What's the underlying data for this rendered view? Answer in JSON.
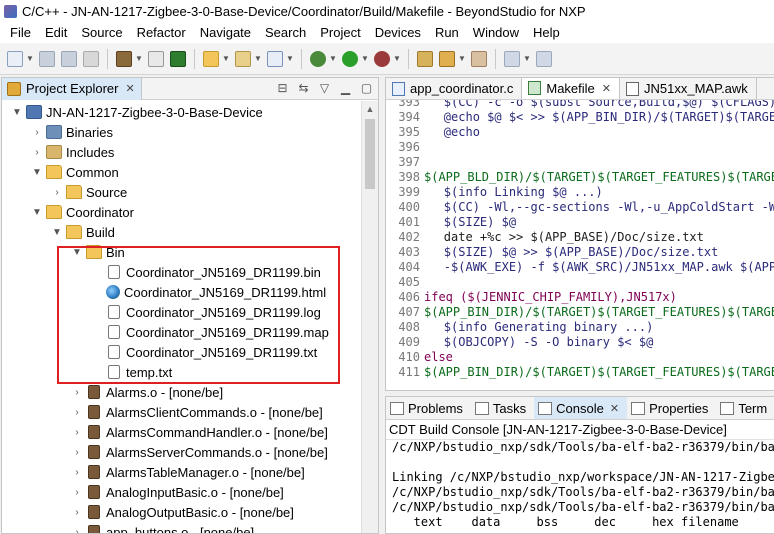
{
  "window": {
    "title": "C/C++ - JN-AN-1217-Zigbee-3-0-Base-Device/Coordinator/Build/Makefile - BeyondStudio for NXP"
  },
  "menu": [
    "File",
    "Edit",
    "Source",
    "Refactor",
    "Navigate",
    "Search",
    "Project",
    "Devices",
    "Run",
    "Window",
    "Help"
  ],
  "explorer": {
    "tab_label": "Project Explorer",
    "close_glyph": "✕",
    "items": [
      {
        "label": "JN-AN-1217-Zigbee-3-0-Base-Device",
        "icon": "project-icon"
      },
      {
        "label": "Binaries",
        "icon": "binaries-icon"
      },
      {
        "label": "Includes",
        "icon": "includes-icon"
      },
      {
        "label": "Common",
        "icon": "folder-icon"
      },
      {
        "label": "Source",
        "icon": "folder-icon"
      },
      {
        "label": "Coordinator",
        "icon": "folder-icon"
      },
      {
        "label": "Build",
        "icon": "folder-icon"
      },
      {
        "label": "Bin",
        "icon": "folder-icon"
      },
      {
        "label": "Coordinator_JN5169_DR1199.bin",
        "icon": "file-icon"
      },
      {
        "label": "Coordinator_JN5169_DR1199.html",
        "icon": "globe-icon"
      },
      {
        "label": "Coordinator_JN5169_DR1199.log",
        "icon": "file-icon"
      },
      {
        "label": "Coordinator_JN5169_DR1199.map",
        "icon": "file-icon"
      },
      {
        "label": "Coordinator_JN5169_DR1199.txt",
        "icon": "file-icon"
      },
      {
        "label": "temp.txt",
        "icon": "file-icon"
      },
      {
        "label": "Alarms.o - [none/be]",
        "icon": "object-file-icon"
      },
      {
        "label": "AlarmsClientCommands.o - [none/be]",
        "icon": "object-file-icon"
      },
      {
        "label": "AlarmsCommandHandler.o - [none/be]",
        "icon": "object-file-icon"
      },
      {
        "label": "AlarmsServerCommands.o - [none/be]",
        "icon": "object-file-icon"
      },
      {
        "label": "AlarmsTableManager.o - [none/be]",
        "icon": "object-file-icon"
      },
      {
        "label": "AnalogInputBasic.o - [none/be]",
        "icon": "object-file-icon"
      },
      {
        "label": "AnalogOutputBasic.o - [none/be]",
        "icon": "object-file-icon"
      },
      {
        "label": "app_buttons.o - [none/be]",
        "icon": "object-file-icon"
      }
    ]
  },
  "editor": {
    "tabs": [
      {
        "label": "app_coordinator.c",
        "active": false
      },
      {
        "label": "Makefile",
        "active": true
      },
      {
        "label": "JN51xx_MAP.awk",
        "active": false
      }
    ],
    "lines": [
      {
        "no": "393",
        "text": "\t$(CC) -c -o $(subst Source,Build,$@) $(CFLAGS)",
        "style": "txt"
      },
      {
        "no": "394",
        "text": "\t@echo $@ $< >> $(APP_BIN_DIR)/$(TARGET)$(TARGET",
        "style": "txt"
      },
      {
        "no": "395",
        "text": "\t@echo",
        "style": "txt"
      },
      {
        "no": "396",
        "text": "",
        "style": "txt"
      },
      {
        "no": "397",
        "text": "",
        "style": "txt"
      },
      {
        "no": "398",
        "text": "$(APP_BLD_DIR)/$(TARGET)$(TARGET_FEATURES)$(TARGET",
        "style": "var"
      },
      {
        "no": "399",
        "text": "\t$(info Linking $@ ...)",
        "style": "txt"
      },
      {
        "no": "400",
        "text": "\t$(CC) -Wl,--gc-sections -Wl,-u_AppColdStart -W",
        "style": "txt"
      },
      {
        "no": "401",
        "text": "\t$(SIZE) $@",
        "style": "txt"
      },
      {
        "no": "402",
        "text": "\tdate +%c >> $(APP_BASE)/Doc/size.txt",
        "style": "def"
      },
      {
        "no": "403",
        "text": "\t$(SIZE) $@ >> $(APP_BASE)/Doc/size.txt",
        "style": "txt"
      },
      {
        "no": "404",
        "text": "\t-$(AWK_EXE) -f $(AWK_SRC)/JN51xx_MAP.awk $(APP",
        "style": "txt"
      },
      {
        "no": "405",
        "text": "",
        "style": "txt"
      },
      {
        "no": "406",
        "text": "ifeq ($(JENNIC_CHIP_FAMILY),JN517x)",
        "style": "kw"
      },
      {
        "no": "407",
        "text": "$(APP_BIN_DIR)/$(TARGET)$(TARGET_FEATURES)$(TARGET",
        "style": "var"
      },
      {
        "no": "408",
        "text": "\t$(info Generating binary ...)",
        "style": "txt"
      },
      {
        "no": "409",
        "text": "\t$(OBJCOPY) -S -O binary $< $@",
        "style": "txt"
      },
      {
        "no": "410",
        "text": "else",
        "style": "kw"
      },
      {
        "no": "411",
        "text": "$(APP_BIN_DIR)/$(TARGET)$(TARGET_FEATURES)$(TARGET",
        "style": "var"
      }
    ]
  },
  "bottom_panel": {
    "tabs": [
      {
        "label": "Problems",
        "active": false
      },
      {
        "label": "Tasks",
        "active": false
      },
      {
        "label": "Console",
        "active": true
      },
      {
        "label": "Properties",
        "active": false
      },
      {
        "label": "Term",
        "active": false
      }
    ],
    "console_title": "CDT Build Console [JN-AN-1217-Zigbee-3-0-Base-Device]",
    "output": [
      "/c/NXP/bstudio_nxp/sdk/Tools/ba-elf-ba2-r36379/bin/ba-e",
      "",
      "Linking /c/NXP/bstudio_nxp/workspace/JN-AN-1217-Zigbee-",
      "/c/NXP/bstudio_nxp/sdk/Tools/ba-elf-ba2-r36379/bin/ba-e",
      "/c/NXP/bstudio_nxp/sdk/Tools/ba-elf-ba2-r36379/bin/ba-e",
      "   text    data     bss     dec     hex filename"
    ]
  },
  "colors": {
    "highlight_box": "#e02020",
    "active_view_tab": "#d9e8f7",
    "line_number": "#787878"
  }
}
